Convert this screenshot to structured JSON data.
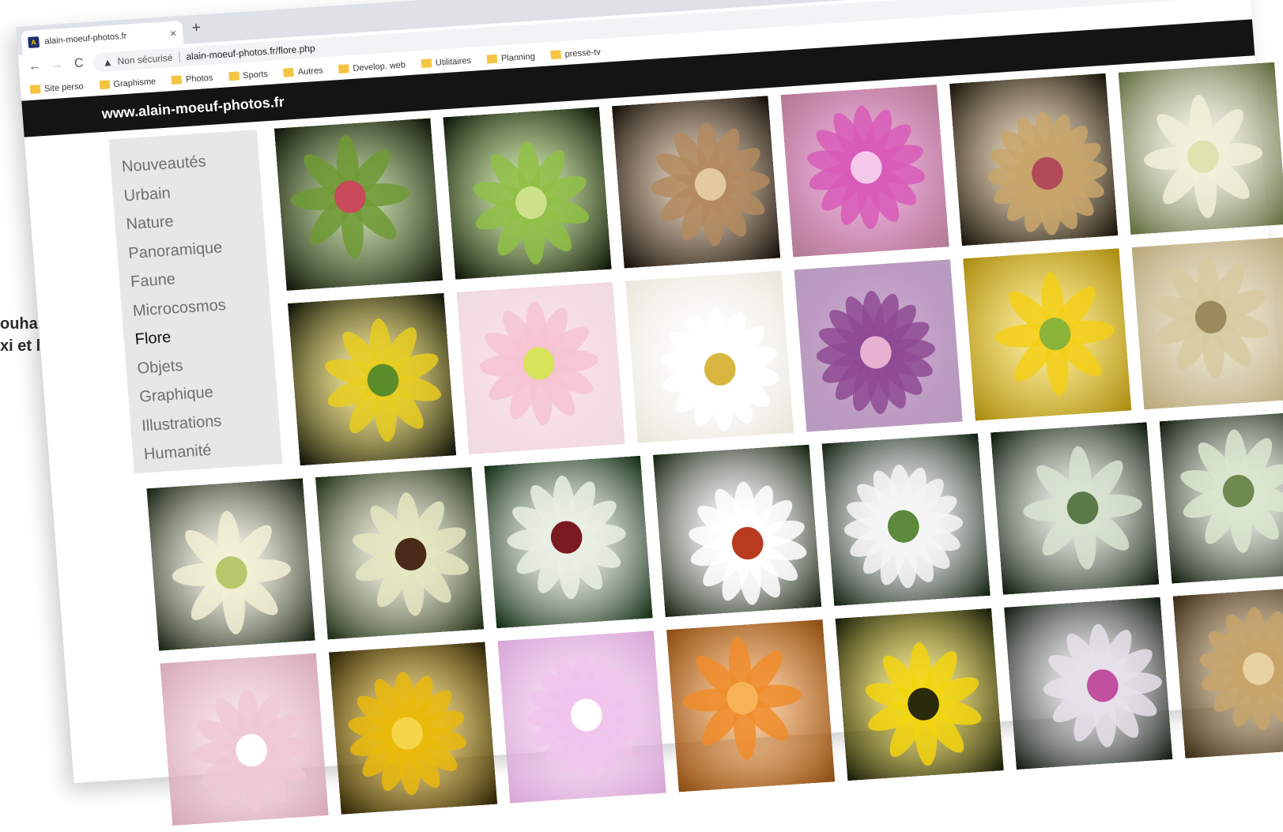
{
  "background_text": {
    "line1": "ouhaitez",
    "line2": "xi et la"
  },
  "browser": {
    "tab": {
      "favicon": "site-favicon",
      "title": "alain-moeuf-photos.fr",
      "close": "×"
    },
    "new_tab": "+",
    "nav": {
      "back": "←",
      "forward": "→",
      "reload": "C"
    },
    "omnibox": {
      "warning_icon": "warning-icon",
      "security_label": "Non sécurisé",
      "url": "alain-moeuf-photos.fr/flore.php"
    },
    "bookmarks": [
      "Site perso",
      "Graphisme",
      "Photos",
      "Sports",
      "Autres",
      "Develop. web",
      "Utilitaires",
      "Planning",
      "presse-tv"
    ]
  },
  "site": {
    "title": "www.alain-moeuf-photos.fr",
    "menu": [
      "Nouveautés",
      "Urbain",
      "Nature",
      "Panoramique",
      "Faune",
      "Microcosmos",
      "Flore",
      "Objets",
      "Graphique",
      "Illustrations",
      "Humanité"
    ],
    "active_menu": "Flore"
  },
  "gallery": {
    "photos": [
      {
        "name": "photo-green-bud",
        "bg": "#0d1308",
        "main": "#6f9a34",
        "accent": "#c94a5a"
      },
      {
        "name": "photo-spiky-green-bud",
        "bg": "#0a1206",
        "main": "#8fbf45",
        "accent": "#cde08a"
      },
      {
        "name": "photo-dried-seedhead",
        "bg": "#120d08",
        "main": "#b38a5e",
        "accent": "#e3c9a1"
      },
      {
        "name": "photo-pink-stamens",
        "bg": "#b07a90",
        "main": "#d85ab8",
        "accent": "#f5c8ea"
      },
      {
        "name": "photo-pink-buds",
        "bg": "#151008",
        "main": "#c9a46a",
        "accent": "#b24a5a"
      },
      {
        "name": "photo-white-cluster",
        "bg": "#5c6a3a",
        "main": "#f1f0d9",
        "accent": "#dfe3b0"
      },
      {
        "name": "photo-yellow-orchid",
        "bg": "#0b0f07",
        "main": "#e7cc1e",
        "accent": "#5b8c2a"
      },
      {
        "name": "photo-pale-pink-flower",
        "bg": "#f0dbe0",
        "main": "#f6c3d2",
        "accent": "#d7e35a"
      },
      {
        "name": "photo-white-flower",
        "bg": "#e9e6da",
        "main": "#ffffff",
        "accent": "#d9b640"
      },
      {
        "name": "photo-purple-flower",
        "bg": "#b79bc0",
        "main": "#8e4a93",
        "accent": "#e7b1d2"
      },
      {
        "name": "photo-yellow-flower",
        "bg": "#a88a10",
        "main": "#f3cf16",
        "accent": "#8bb43b"
      },
      {
        "name": "photo-fuzzy-leaf",
        "bg": "#b9a77a",
        "main": "#d7caa0",
        "accent": "#9a8a5e"
      }
    ],
    "photos_row3": [
      {
        "name": "photo-white-star-flowers",
        "bg": "#152010",
        "main": "#f2f0d4",
        "accent": "#b8c86a"
      },
      {
        "name": "photo-queen-annes-lace",
        "bg": "#1b2a12",
        "main": "#e4e6bf",
        "accent": "#4a2a18"
      },
      {
        "name": "photo-dandelion-clock",
        "bg": "#0f2a10",
        "main": "#e9eee4",
        "accent": "#7a1b22"
      },
      {
        "name": "photo-red-berries",
        "bg": "#14200e",
        "main": "#ffffff",
        "accent": "#b83b1f"
      },
      {
        "name": "photo-white-berries",
        "bg": "#102010",
        "main": "#f5f5f5",
        "accent": "#5a8a3a"
      },
      {
        "name": "photo-white-buds",
        "bg": "#0c170b",
        "main": "#d8e3d0",
        "accent": "#5a7a48"
      },
      {
        "name": "photo-green-buds",
        "bg": "#101a0c",
        "main": "#dbe6d0",
        "accent": "#6f8a50"
      }
    ],
    "photos_row4": [
      {
        "name": "photo-pink-blur",
        "bg": "#d6a7b8",
        "main": "#efc9d5",
        "accent": "#ffffff"
      },
      {
        "name": "photo-yellow-petals",
        "bg": "#2a2004",
        "main": "#e9b80c",
        "accent": "#f5d64a"
      },
      {
        "name": "photo-lilac-petals",
        "bg": "#d7a5d6",
        "main": "#f0c4ec",
        "accent": "#ffffff"
      },
      {
        "name": "photo-orange-rose",
        "bg": "#8a4a10",
        "main": "#f08c2a",
        "accent": "#f7b255"
      },
      {
        "name": "photo-yellow-daisy",
        "bg": "#141a08",
        "main": "#f2d50e",
        "accent": "#2a2a0a"
      },
      {
        "name": "photo-pink-sphere",
        "bg": "#0e190c",
        "main": "#e6e0ea",
        "accent": "#c04fa0"
      },
      {
        "name": "photo-dry-petals",
        "bg": "#3a2a14",
        "main": "#c7a36a",
        "accent": "#e8d2a2"
      }
    ]
  }
}
